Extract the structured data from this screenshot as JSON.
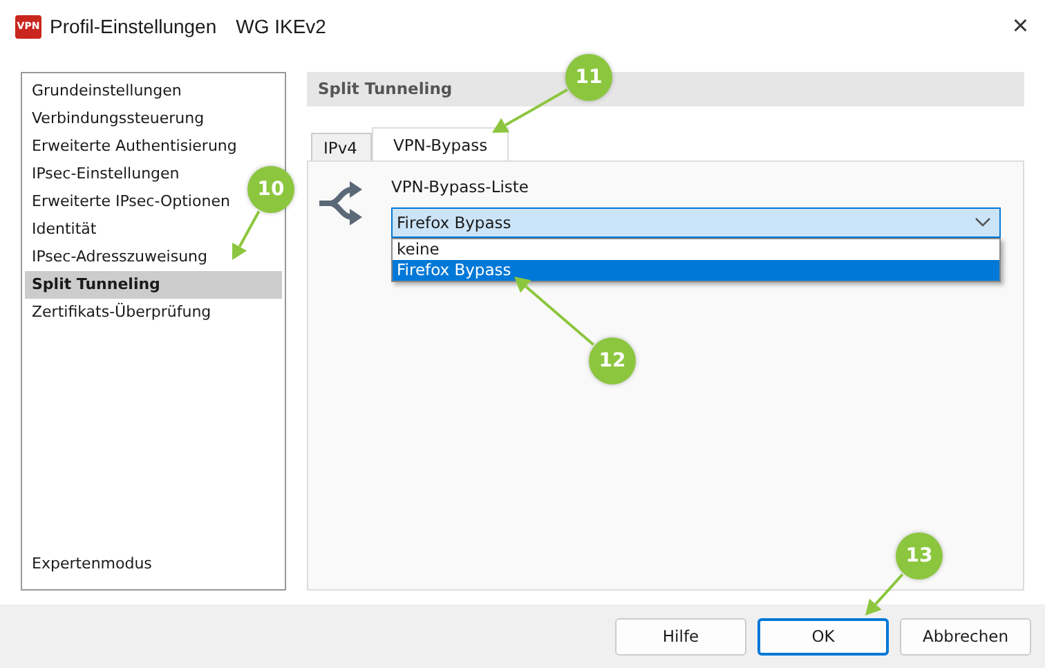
{
  "window": {
    "title": "Profil-Einstellungen",
    "profile": "WG IKEv2",
    "app_icon_text": "VPN",
    "close": "×"
  },
  "sidebar": {
    "items": [
      {
        "label": "Grundeinstellungen",
        "selected": false
      },
      {
        "label": "Verbindungssteuerung",
        "selected": false
      },
      {
        "label": "Erweiterte Authentisierung",
        "selected": false
      },
      {
        "label": "IPsec-Einstellungen",
        "selected": false
      },
      {
        "label": "Erweiterte IPsec-Optionen",
        "selected": false
      },
      {
        "label": "Identität",
        "selected": false
      },
      {
        "label": "IPsec-Adresszuweisung",
        "selected": false
      },
      {
        "label": "Split Tunneling",
        "selected": true
      },
      {
        "label": "Zertifikats-Überprüfung",
        "selected": false
      }
    ],
    "footer_item": "Expertenmodus"
  },
  "panel": {
    "heading": "Split Tunneling",
    "tabs": [
      {
        "label": "IPv4",
        "selected": false
      },
      {
        "label": "VPN-Bypass",
        "selected": true
      }
    ],
    "field_label": "VPN-Bypass-Liste",
    "dropdown": {
      "value": "Firefox Bypass",
      "expanded": true,
      "options": [
        {
          "label": "keine",
          "selected": false
        },
        {
          "label": "Firefox Bypass",
          "selected": true
        }
      ]
    }
  },
  "buttons": [
    {
      "label": "Hilfe",
      "default": false
    },
    {
      "label": "OK",
      "default": true
    },
    {
      "label": "Abbrechen",
      "default": false
    }
  ],
  "callouts": [
    {
      "number": "10"
    },
    {
      "number": "11"
    },
    {
      "number": "12"
    },
    {
      "number": "13"
    }
  ]
}
